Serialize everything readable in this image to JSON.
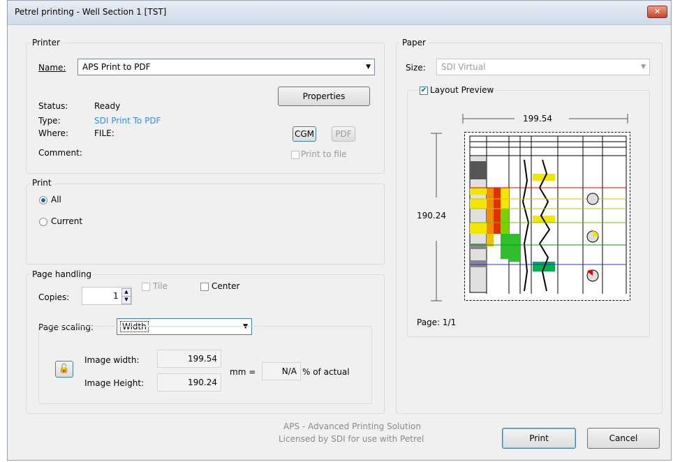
{
  "window": {
    "title": "Petrel printing - Well Section 1 [TST]",
    "close_glyph": "✕"
  },
  "printer": {
    "legend": "Printer",
    "name_label": "Name:",
    "name_value": "APS Print to PDF",
    "properties_button": "Properties",
    "status_label": "Status:",
    "status_value": "Ready",
    "type_label": "Type:",
    "type_value": "SDI Print To PDF",
    "where_label": "Where:",
    "where_value": "FILE:",
    "comment_label": "Comment:",
    "cgm_button": "CGM",
    "pdf_button": "PDF",
    "print_to_file_label": "Print to file"
  },
  "print": {
    "legend": "Print",
    "options": [
      {
        "label": "All",
        "checked": true
      },
      {
        "label": "Current",
        "checked": false
      }
    ]
  },
  "page_handling": {
    "legend": "Page handling",
    "copies_label": "Copies:",
    "copies_value": "1",
    "tile_label": "Tile",
    "center_label": "Center",
    "scaling_label": "Page scaling:",
    "scaling_value": "Width",
    "image_width_label": "Image width:",
    "image_width_value": "199.54",
    "image_height_label": "Image Height:",
    "image_height_value": "190.24",
    "mm_label": "mm =",
    "percent_value": "N/A",
    "percent_label": "% of actual"
  },
  "paper": {
    "legend": "Paper",
    "size_label": "Size:",
    "size_value": "SDI Virtual",
    "layout_preview_label": "Layout Preview",
    "layout_preview_checked": true,
    "preview_width": "199.54",
    "preview_height": "190.24",
    "page_label": "Page: 1/1"
  },
  "footer": {
    "license_line1": "APS - Advanced Printing Solution",
    "license_line2": "Licensed by SDI for use with Petrel",
    "print_button": "Print",
    "cancel_button": "Cancel"
  }
}
